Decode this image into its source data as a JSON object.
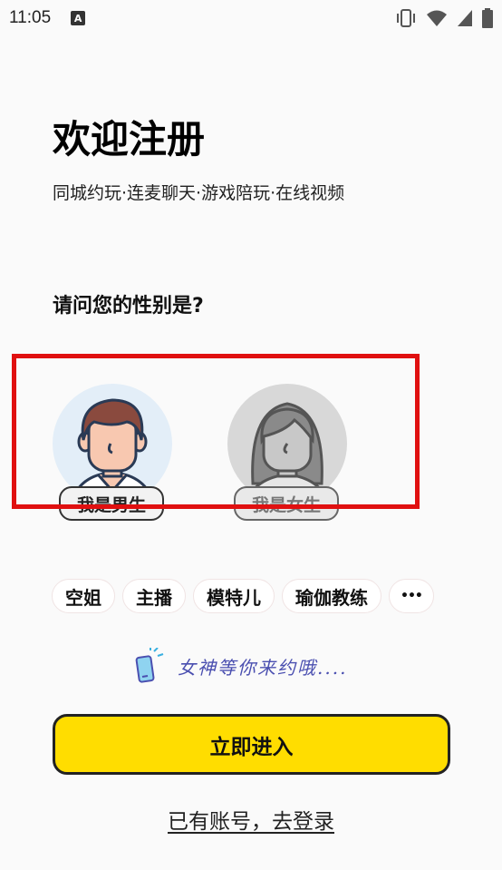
{
  "status_bar": {
    "time": "11:05",
    "notification_letter": "A",
    "icons": [
      "vibrate-icon",
      "wifi-icon",
      "signal-icon",
      "battery-icon"
    ]
  },
  "header": {
    "title": "欢迎注册",
    "subtitle": "同城约玩·连麦聊天·游戏陪玩·在线视频"
  },
  "gender": {
    "question": "请问您的性别是?",
    "male_label": "我是男生",
    "female_label": "我是女生"
  },
  "tags": [
    "空姐",
    "主播",
    "模特儿",
    "瑜伽教练"
  ],
  "more_tag": "•••",
  "slogan": "女神等你来约哦....",
  "actions": {
    "enter_label": "立即进入",
    "login_label": "已有账号，去登录"
  },
  "colors": {
    "accent_yellow": "#ffdd00",
    "highlight_red": "#e01010",
    "slogan_blue": "#4a4fb0"
  }
}
